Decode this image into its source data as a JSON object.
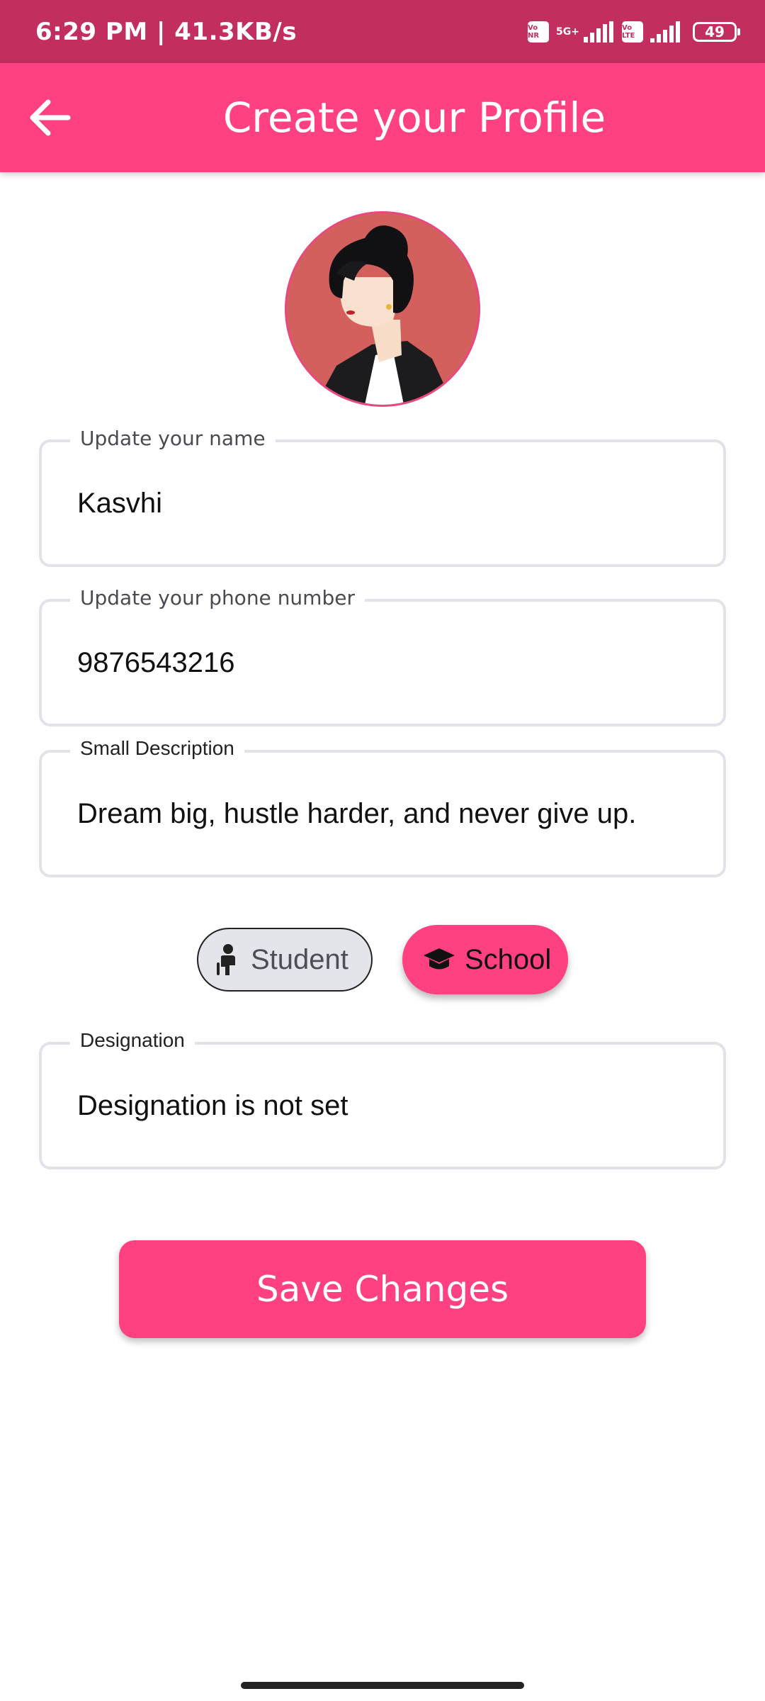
{
  "status_bar": {
    "time_speed": "6:29 PM | 41.3KB/s",
    "sim1_label": "Vo NR",
    "network_type": "5G+",
    "sim2_label": "Vo LTE",
    "battery": "49"
  },
  "app_bar": {
    "title": "Create your Profile"
  },
  "form": {
    "name": {
      "label": "Update your name",
      "value": "Kasvhi"
    },
    "phone": {
      "label": "Update your phone number",
      "value": "9876543216"
    },
    "description": {
      "label": "Small Description",
      "value": "Dream big, hustle harder, and never give up."
    },
    "designation": {
      "label": "Designation",
      "value": "Designation is not set"
    }
  },
  "role_chips": {
    "student_label": "Student",
    "school_label": "School",
    "selected": "School"
  },
  "actions": {
    "save_label": "Save Changes"
  },
  "colors": {
    "status_bar": "#c22f5e",
    "primary": "#ff4081",
    "field_border": "#e2e2e8",
    "avatar_bg": "#d4605e"
  }
}
